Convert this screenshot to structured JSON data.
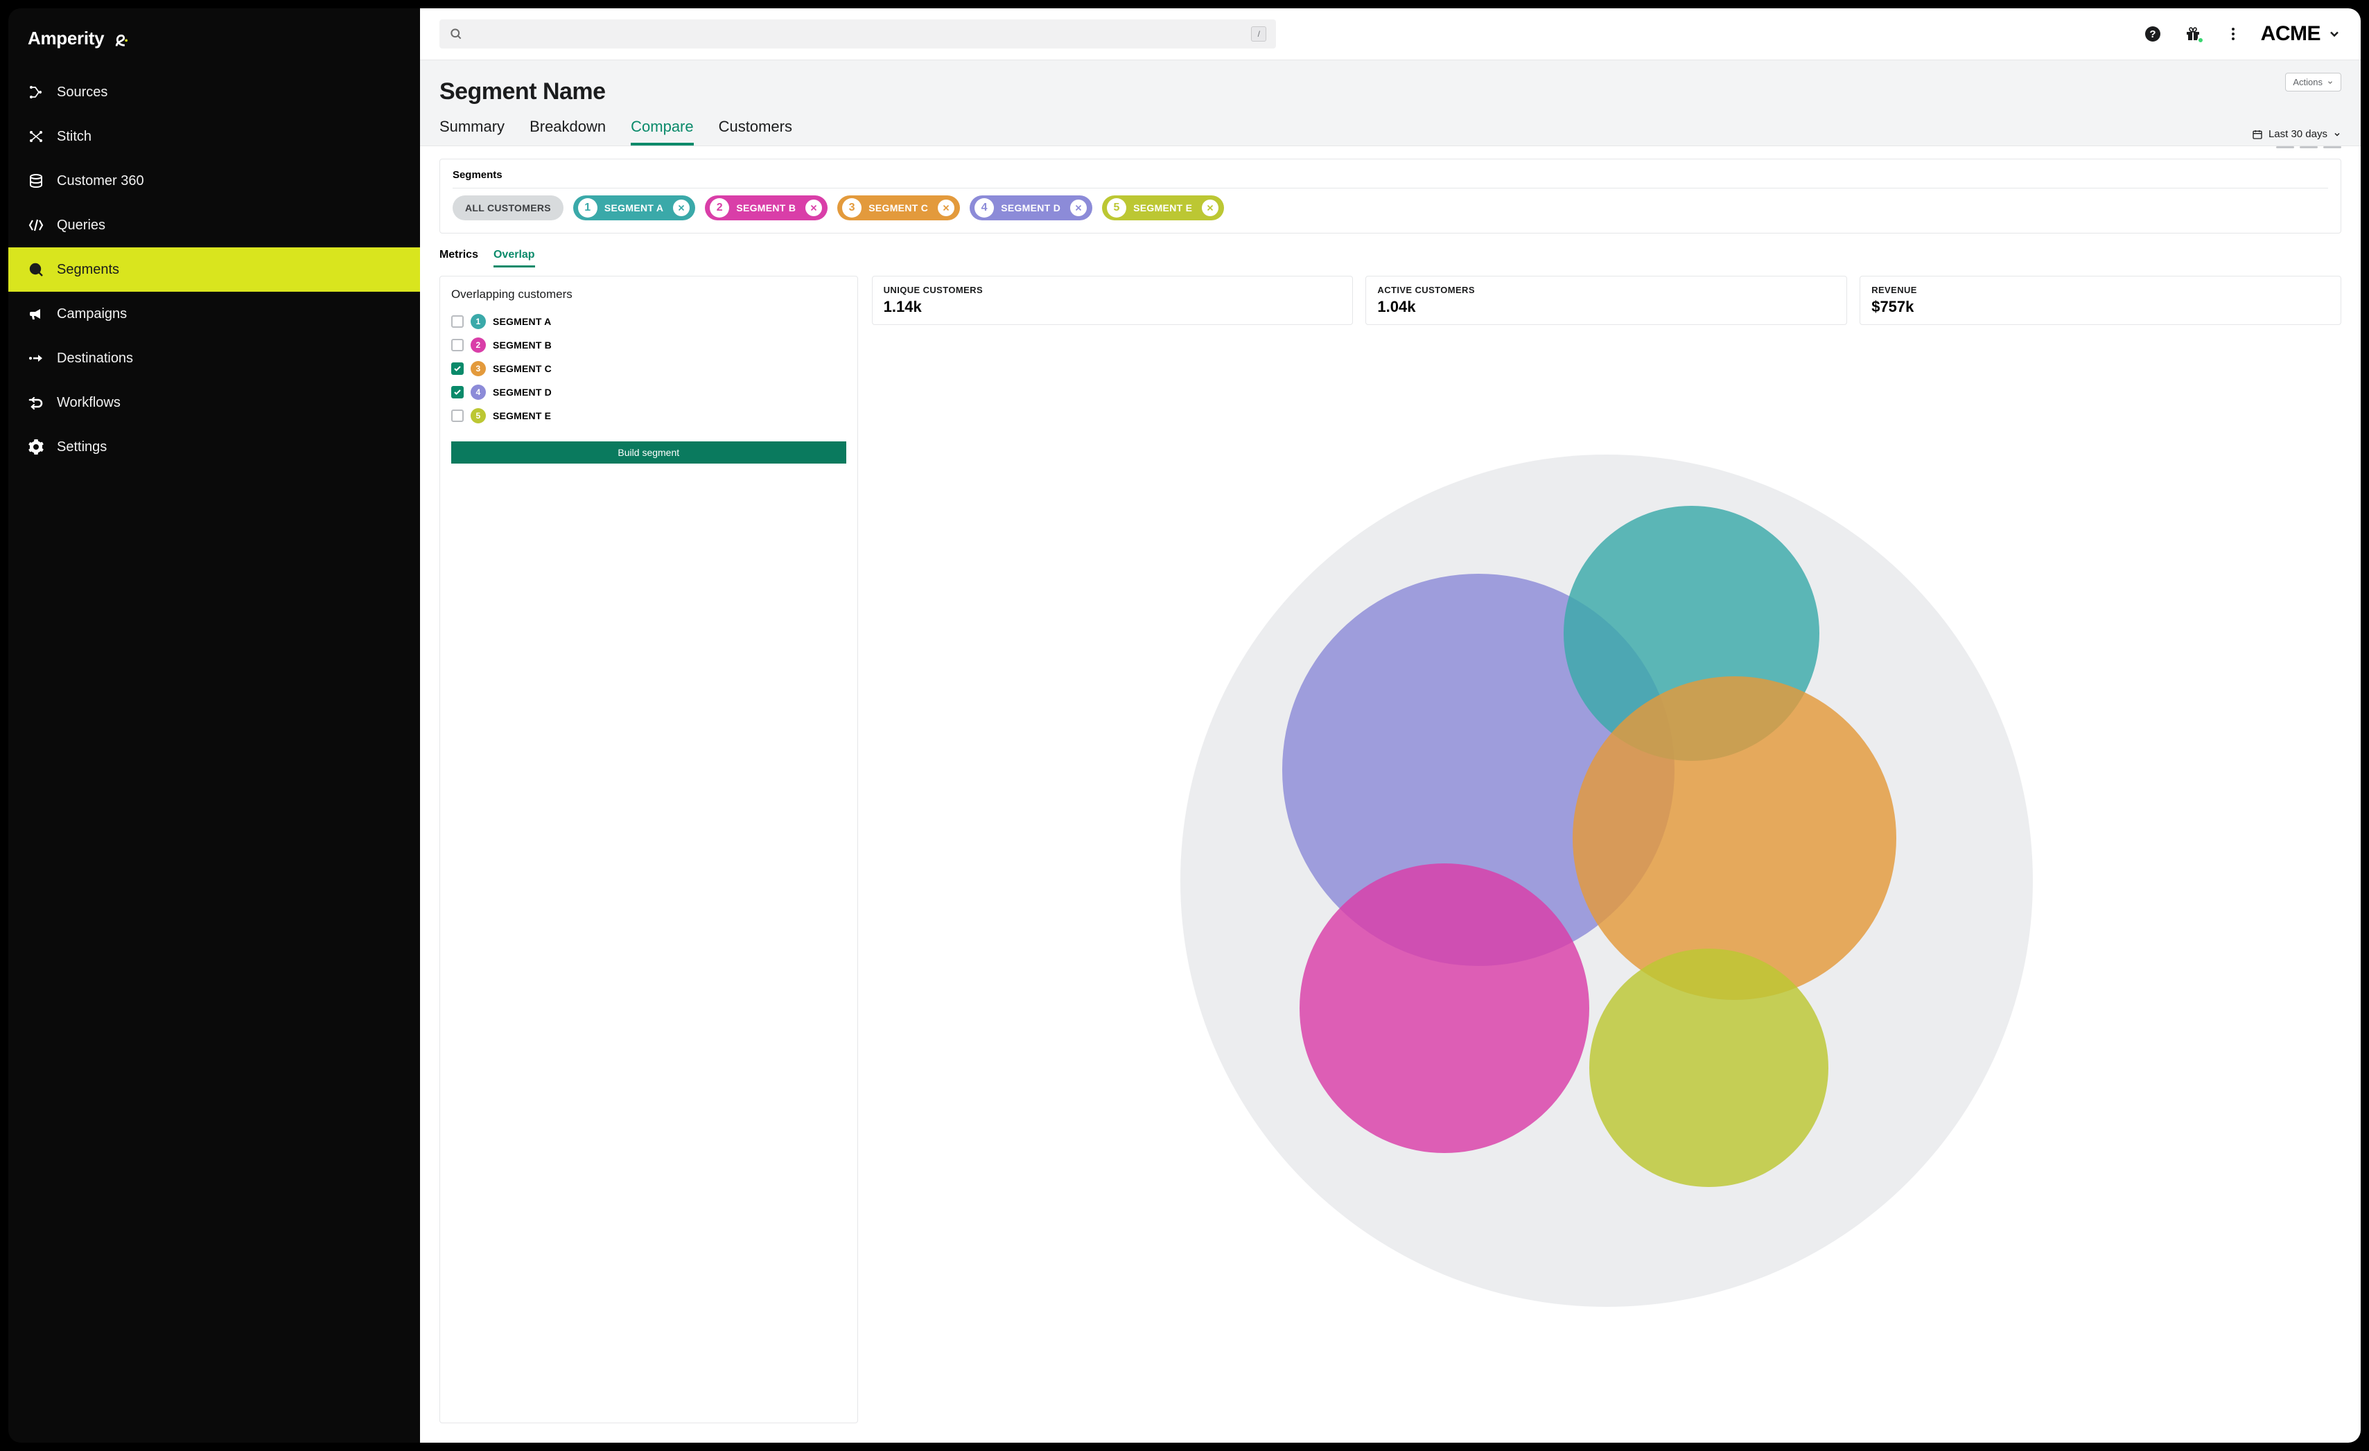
{
  "brand": "Amperity",
  "tenant": "ACME",
  "search": {
    "placeholder": "",
    "slash_hint": "/"
  },
  "sidebar": {
    "items": [
      {
        "label": "Sources",
        "icon": "sources-icon"
      },
      {
        "label": "Stitch",
        "icon": "stitch-icon"
      },
      {
        "label": "Customer 360",
        "icon": "customer360-icon"
      },
      {
        "label": "Queries",
        "icon": "queries-icon"
      },
      {
        "label": "Segments",
        "icon": "segments-icon",
        "active": true
      },
      {
        "label": "Campaigns",
        "icon": "campaigns-icon"
      },
      {
        "label": "Destinations",
        "icon": "destinations-icon"
      },
      {
        "label": "Workflows",
        "icon": "workflows-icon"
      },
      {
        "label": "Settings",
        "icon": "settings-icon"
      }
    ]
  },
  "page": {
    "title": "Segment Name",
    "actions_label": "Actions",
    "date_range": "Last 30 days",
    "tabs": [
      {
        "label": "Summary"
      },
      {
        "label": "Breakdown"
      },
      {
        "label": "Compare",
        "active": true
      },
      {
        "label": "Customers"
      }
    ]
  },
  "segments_strip": {
    "title": "Segments",
    "all_label": "ALL CUSTOMERS",
    "items": [
      {
        "num": "1",
        "label": "SEGMENT A",
        "color": "teal"
      },
      {
        "num": "2",
        "label": "SEGMENT B",
        "color": "magenta"
      },
      {
        "num": "3",
        "label": "SEGMENT C",
        "color": "orange"
      },
      {
        "num": "4",
        "label": "SEGMENT D",
        "color": "lavender"
      },
      {
        "num": "5",
        "label": "SEGMENT E",
        "color": "olive"
      }
    ]
  },
  "subtabs": [
    {
      "label": "Metrics"
    },
    {
      "label": "Overlap",
      "active": true
    }
  ],
  "overlap_panel": {
    "title": "Overlapping customers",
    "build_label": "Build segment",
    "rows": [
      {
        "num": "1",
        "label": "SEGMENT A",
        "color": "teal",
        "checked": false
      },
      {
        "num": "2",
        "label": "SEGMENT B",
        "color": "magenta",
        "checked": false
      },
      {
        "num": "3",
        "label": "SEGMENT C",
        "color": "orange",
        "checked": true
      },
      {
        "num": "4",
        "label": "SEGMENT D",
        "color": "lavender",
        "checked": true
      },
      {
        "num": "5",
        "label": "SEGMENT E",
        "color": "olive",
        "checked": false
      }
    ]
  },
  "stats": [
    {
      "k": "UNIQUE CUSTOMERS",
      "v": "1.14k"
    },
    {
      "k": "ACTIVE CUSTOMERS",
      "v": "1.04k"
    },
    {
      "k": "REVENUE",
      "v": "$757k"
    }
  ],
  "colors": {
    "teal": "#3aa9a9",
    "magenta": "#d93ea8",
    "orange": "#e39a3c",
    "lavender": "#8c8bd8",
    "olive": "#bcc733",
    "accent_green": "#0a8a6a",
    "highlight_yellow": "#d9e51e"
  }
}
